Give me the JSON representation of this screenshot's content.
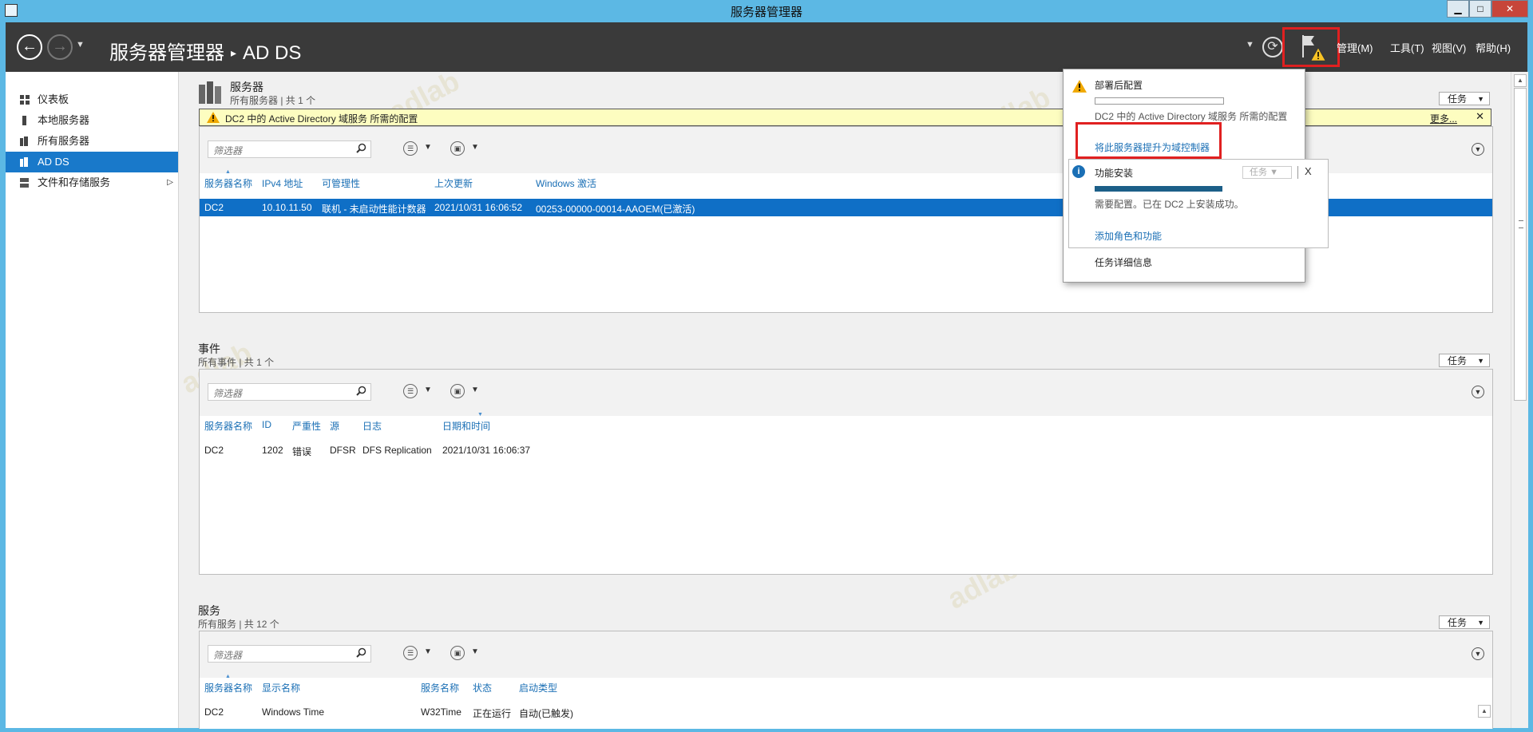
{
  "window": {
    "title": "服务器管理器",
    "controls": {
      "minimize": "▁",
      "maximize": "□",
      "close": "✕"
    }
  },
  "header": {
    "breadcrumb_root": "服务器管理器",
    "breadcrumb_sep": "▸",
    "breadcrumb_current": "AD DS",
    "menus": [
      "管理(M)",
      "工具(T)",
      "视图(V)",
      "帮助(H)"
    ]
  },
  "sidebar": {
    "items": [
      {
        "label": "仪表板",
        "icon": "dashboard-icon"
      },
      {
        "label": "本地服务器",
        "icon": "local-server-icon"
      },
      {
        "label": "所有服务器",
        "icon": "all-servers-icon"
      },
      {
        "label": "AD DS",
        "icon": "adds-icon",
        "active": true
      },
      {
        "label": "文件和存储服务",
        "icon": "file-storage-icon",
        "expandable": true
      }
    ]
  },
  "servers": {
    "title": "服务器",
    "subtitle": "所有服务器 | 共 1 个",
    "tasks_label": "任务",
    "alert_text": "DC2 中的 Active Directory 域服务 所需的配置",
    "alert_more": "更多...",
    "filter_placeholder": "筛选器",
    "columns": [
      "服务器名称",
      "IPv4 地址",
      "可管理性",
      "上次更新",
      "Windows 激活"
    ],
    "rows": [
      [
        "DC2",
        "10.10.11.50",
        "联机 - 未启动性能计数器",
        "2021/10/31 16:06:52",
        "00253-00000-00014-AAOEM(已激活)"
      ]
    ]
  },
  "events": {
    "title": "事件",
    "subtitle": "所有事件 | 共 1 个",
    "tasks_label": "任务",
    "filter_placeholder": "筛选器",
    "columns": [
      "服务器名称",
      "ID",
      "严重性",
      "源",
      "日志",
      "日期和时间"
    ],
    "rows": [
      [
        "DC2",
        "1202",
        "错误",
        "DFSR",
        "DFS Replication",
        "2021/10/31 16:06:37"
      ]
    ]
  },
  "services": {
    "title": "服务",
    "subtitle": "所有服务 | 共 12 个",
    "tasks_label": "任务",
    "filter_placeholder": "筛选器",
    "columns": [
      "服务器名称",
      "显示名称",
      "服务名称",
      "状态",
      "启动类型"
    ],
    "rows": [
      [
        "DC2",
        "Windows Time",
        "W32Time",
        "正在运行",
        "自动(已触发)"
      ]
    ]
  },
  "notifications": {
    "post_deploy_title": "部署后配置",
    "post_deploy_text": "DC2 中的 Active Directory 域服务 所需的配置",
    "promote_link": "将此服务器提升为域控制器",
    "feature_title": "功能安装",
    "feature_tasks": "任务",
    "feature_close": "X",
    "feature_text": "需要配置。已在 DC2 上安装成功。",
    "feature_progress": 1.0,
    "add_roles_link": "添加角色和功能",
    "task_details": "任务详细信息"
  },
  "colors": {
    "titlebar": "#5cb8e4",
    "header": "#3a3a3a",
    "selection": "#0f6fc6",
    "alert_bg": "#fdfdc0",
    "highlight_box": "#e02020",
    "link": "#1a6fb5"
  },
  "watermark": "adlab"
}
